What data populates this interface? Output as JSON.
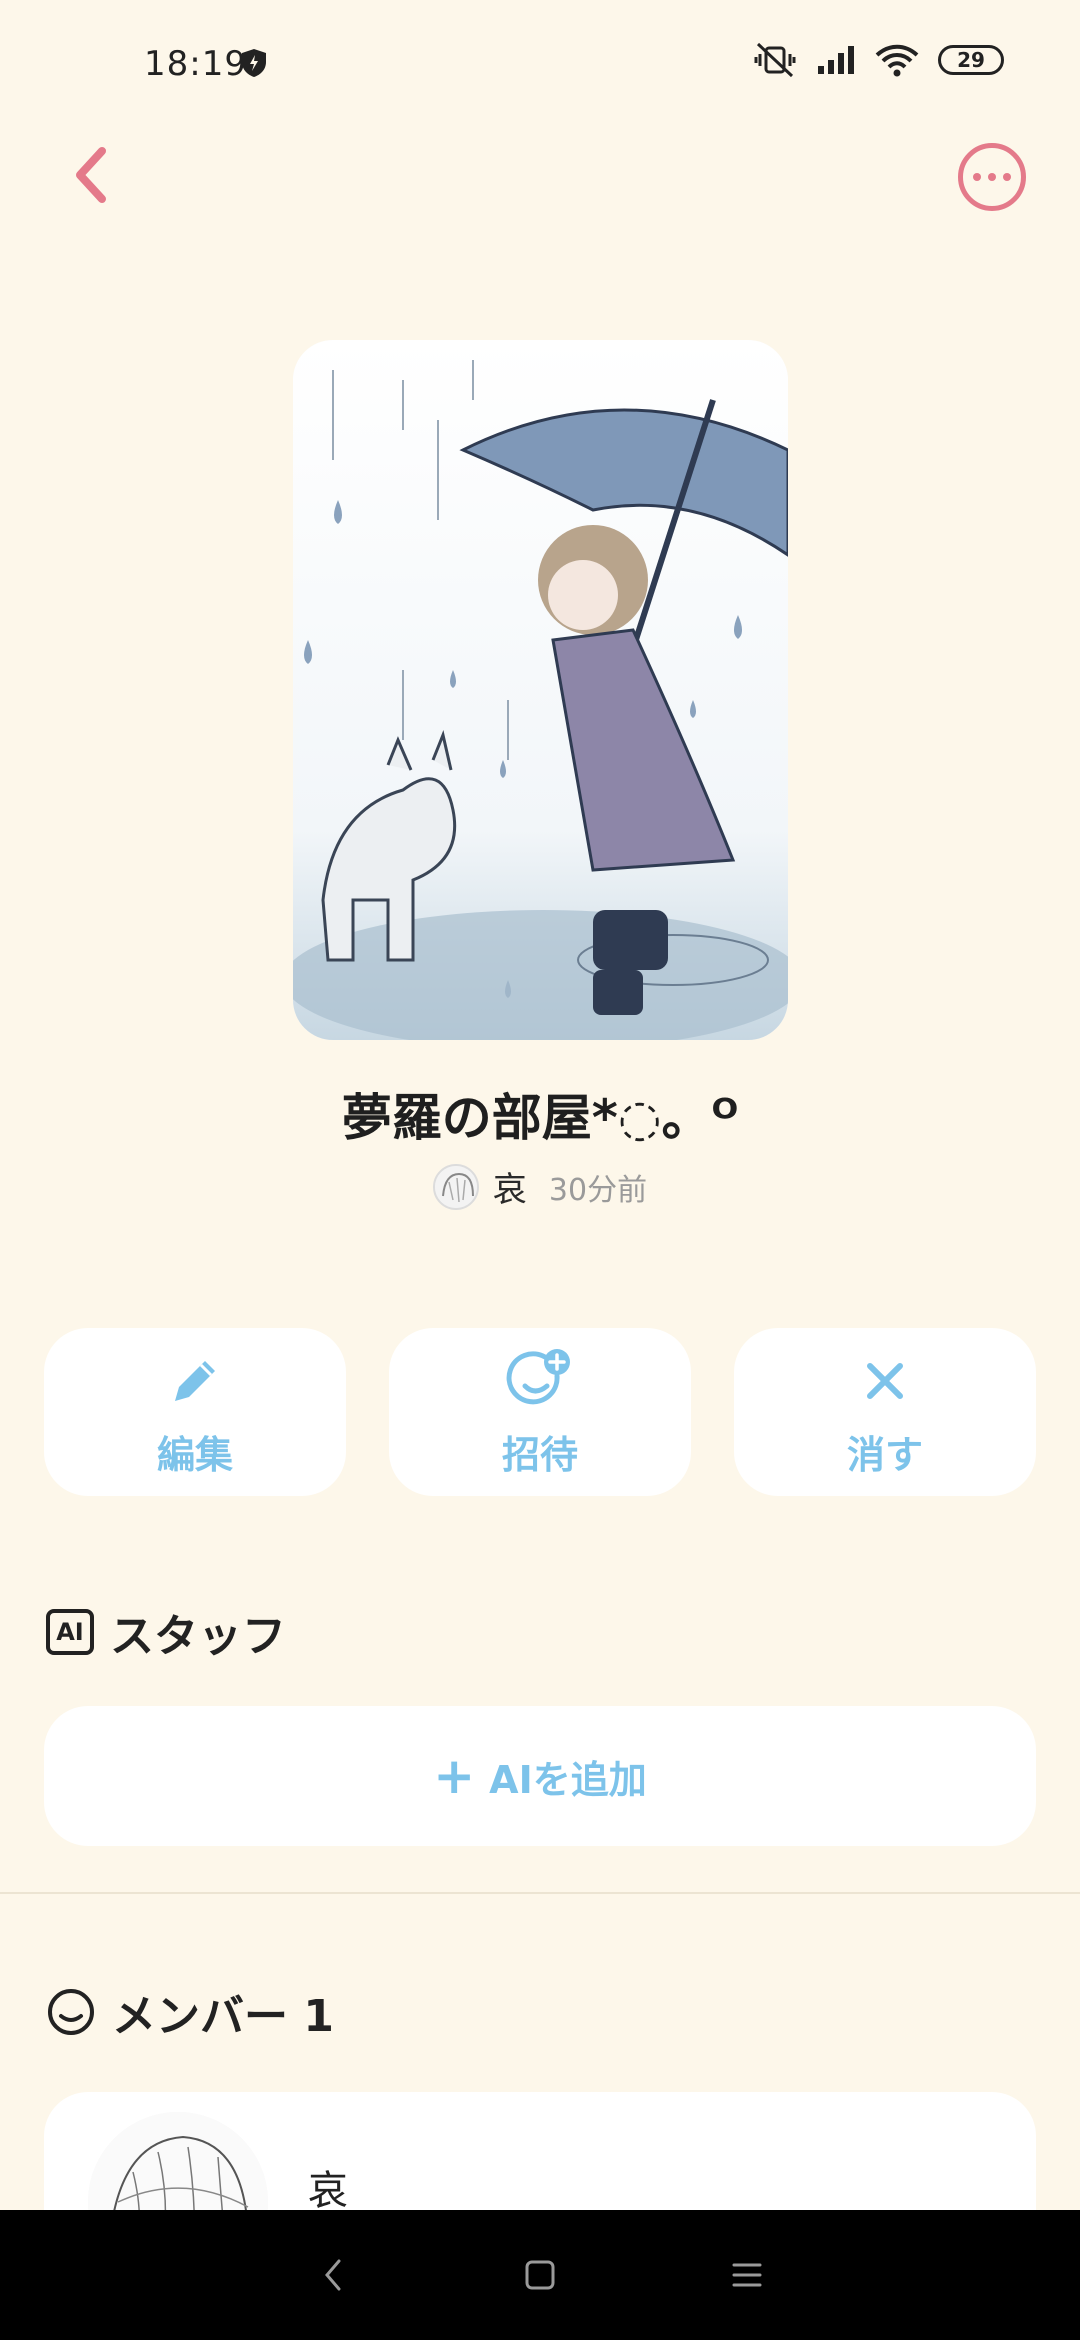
{
  "status_bar": {
    "time": "18:19",
    "battery": "29"
  },
  "header": {
    "back_icon": "chevron-left-icon",
    "more_icon": "more-horizontal-icon",
    "accent_color": "#e47a8a"
  },
  "room": {
    "title": "夢羅の部屋*◌。ᴼ",
    "owner_name": "哀",
    "updated": "30分前"
  },
  "actions": {
    "edit_label": "編集",
    "invite_label": "招待",
    "delete_label": "消す",
    "accent_color": "#7dc3ea"
  },
  "staff": {
    "badge": "AI",
    "title": "スタッフ",
    "add_label": "AIを追加",
    "add_icon": "+"
  },
  "members": {
    "title": "メンバー 1",
    "items": [
      {
        "name": "哀"
      }
    ]
  },
  "nav": {
    "back_icon": "nav-back-icon",
    "home_icon": "nav-home-icon",
    "recents_icon": "nav-recents-icon"
  }
}
